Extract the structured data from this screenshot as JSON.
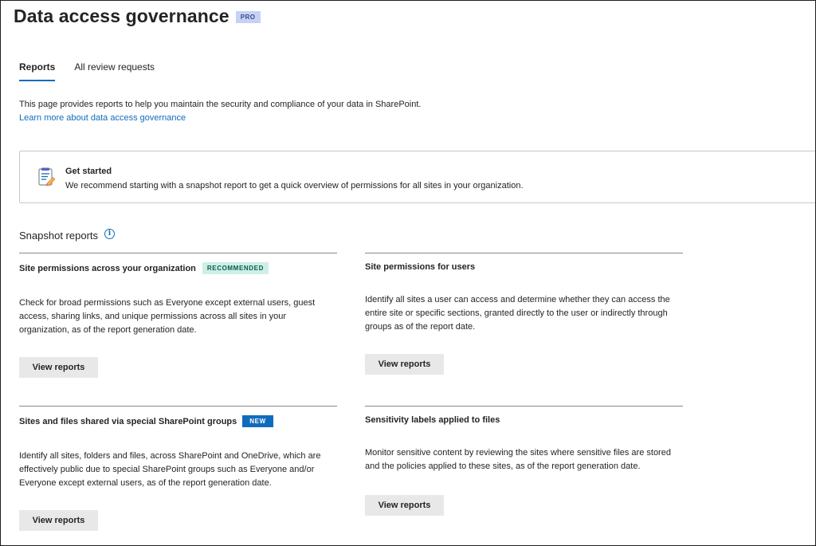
{
  "header": {
    "title": "Data access governance",
    "badge": "PRO"
  },
  "tabs": [
    {
      "label": "Reports",
      "active": true
    },
    {
      "label": "All review requests",
      "active": false
    }
  ],
  "intro": {
    "text": "This page provides reports to help you maintain the security and compliance of your data in SharePoint.",
    "link": "Learn more about data access governance"
  },
  "get_started": {
    "title": "Get started",
    "text": "We recommend starting with a snapshot report to get a quick overview of permissions for all sites in your organization.",
    "icon": "document-edit-icon"
  },
  "section": {
    "title": "Snapshot reports",
    "info_icon": "info-icon"
  },
  "cards": [
    {
      "title": "Site permissions across your organization",
      "badge": "RECOMMENDED",
      "description": "Check for broad permissions such as Everyone except external users, guest access, sharing links, and unique permissions across all sites in your organization, as of the report generation date.",
      "button": "View reports"
    },
    {
      "title": "Site permissions for users",
      "description": "Identify all sites a user can access and determine whether they can access the entire site or specific sections, granted directly to the user or indirectly through groups as of the report date.",
      "button": "View reports"
    },
    {
      "title": "Sites and files shared via special SharePoint groups",
      "badge": "NEW",
      "description": "Identify all sites, folders and files, across SharePoint and OneDrive, which are effectively public due to special SharePoint groups such as Everyone and/or Everyone except external users, as of the report generation date.",
      "button": "View reports"
    },
    {
      "title": "Sensitivity labels applied to files",
      "description": "Monitor sensitive content by reviewing the sites where sensitive files are stored and the policies applied to these sites, as of the report generation date.",
      "button": "View reports"
    }
  ],
  "colors": {
    "accent": "#0f6cbd",
    "recommended_bg": "#cdefe7",
    "pro_bg": "#c7d1f5"
  }
}
